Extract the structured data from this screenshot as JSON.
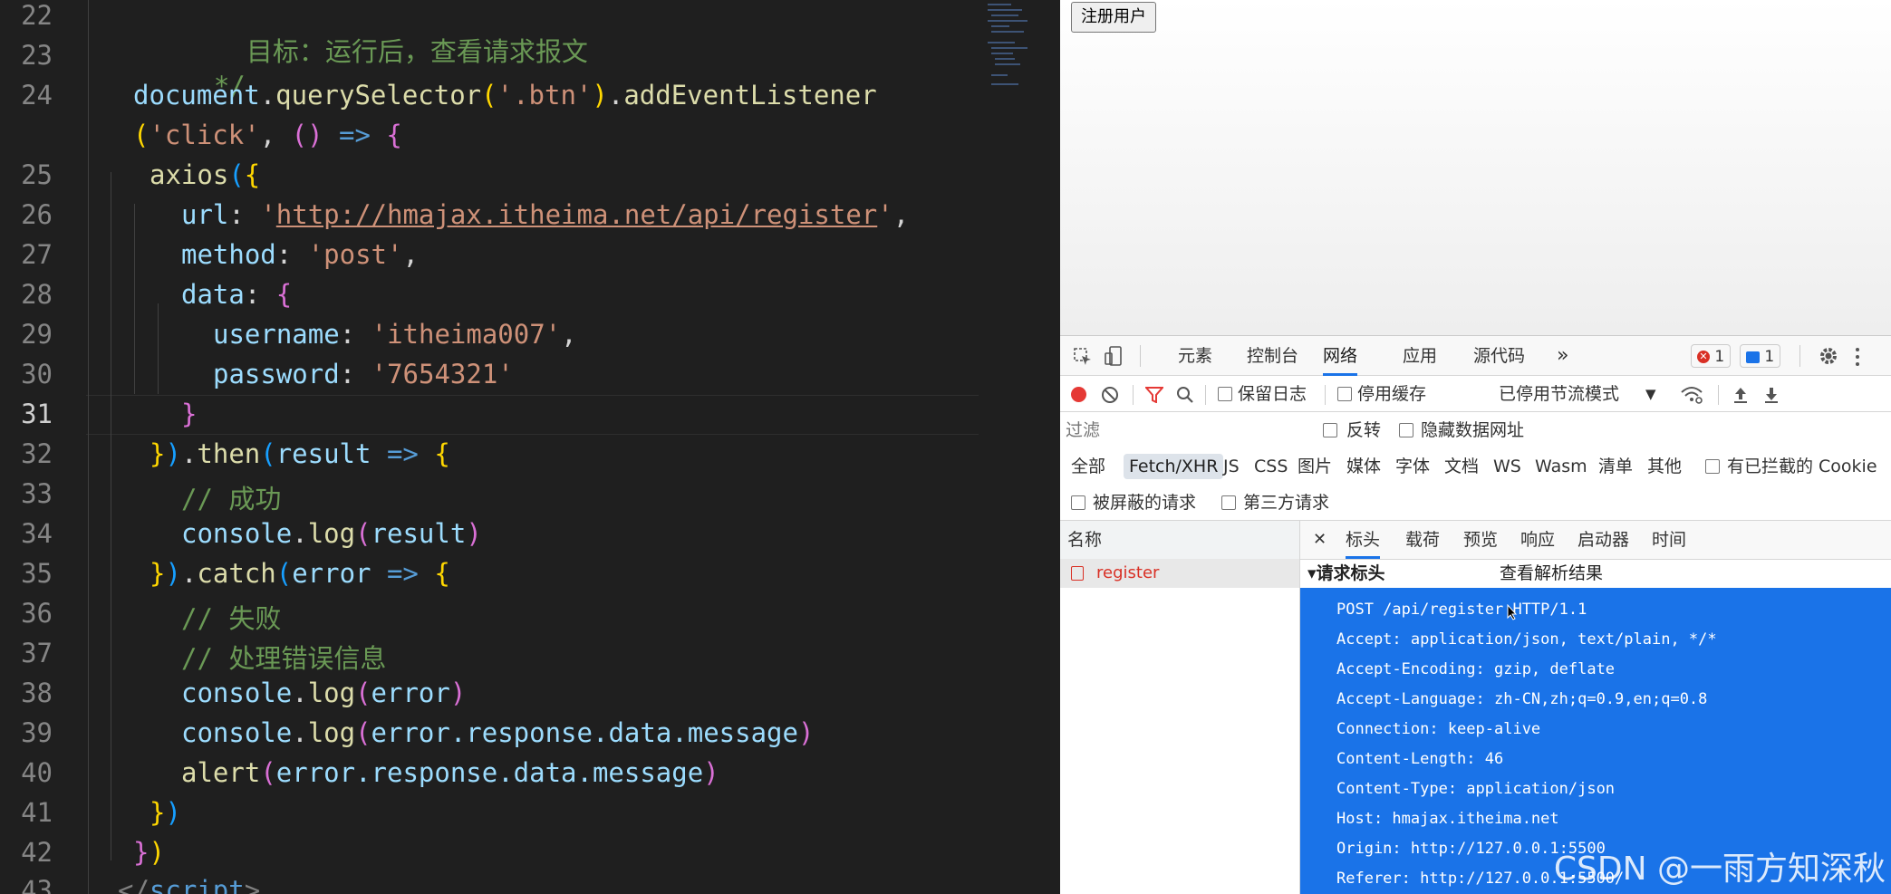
{
  "editor": {
    "line_numbers": [
      "22",
      "23",
      "24",
      "",
      "25",
      "26",
      "27",
      "28",
      "29",
      "30",
      "31",
      "32",
      "33",
      "34",
      "35",
      "36",
      "37",
      "38",
      "39",
      "40",
      "41",
      "42",
      "43"
    ],
    "active_line": "31",
    "code": {
      "l22": "目标：运行后，查看请求报文",
      "l23": "*/",
      "l24_doc": "document",
      "l24_dot": ".",
      "l24_qs": "querySelector",
      "l24_p1": "(",
      "l24_sel": "'.btn'",
      "l24_p2": ")",
      "l24_dot2": ".",
      "l24_ael": "addEventListener",
      "l24b_p": "(",
      "l24b_evt": "'click'",
      "l24b_c": ", ",
      "l24b_args": "()",
      "l24b_arrow": " => ",
      "l24b_brace": "{",
      "l25_axios": "axios",
      "l25_p": "(",
      "l25_b": "{",
      "l26_key": "url",
      "l26_colon": ": ",
      "l26_q1": "'",
      "l26_url": "http://hmajax.itheima.net/api/register",
      "l26_q2": "'",
      "l26_comma": ",",
      "l27_key": "method",
      "l27_colon": ": ",
      "l27_val": "'post'",
      "l27_comma": ",",
      "l28_key": "data",
      "l28_colon": ": ",
      "l28_b": "{",
      "l29_key": "username",
      "l29_colon": ": ",
      "l29_val": "'itheima007'",
      "l29_comma": ",",
      "l30_key": "password",
      "l30_colon": ": ",
      "l30_val": "'7654321'",
      "l31_b": "}",
      "l32_b": "}",
      "l32_p": ")",
      "l32_dot": ".",
      "l32_then": "then",
      "l32_p2": "(",
      "l32_arg": "result",
      "l32_arrow": " => ",
      "l32_brace": "{",
      "l33_cmt": "// 成功",
      "l34_obj": "console",
      "l34_dot": ".",
      "l34_fn": "log",
      "l34_p1": "(",
      "l34_arg": "result",
      "l34_p2": ")",
      "l35_b": "}",
      "l35_p": ")",
      "l35_dot": ".",
      "l35_catch": "catch",
      "l35_p2": "(",
      "l35_arg": "error",
      "l35_arrow": " => ",
      "l35_brace": "{",
      "l36_cmt": "// 失败",
      "l37_cmt": "// 处理错误信息",
      "l38_obj": "console",
      "l38_dot": ".",
      "l38_fn": "log",
      "l38_p1": "(",
      "l38_arg": "error",
      "l38_p2": ")",
      "l39_obj": "console",
      "l39_dot": ".",
      "l39_fn": "log",
      "l39_p1": "(",
      "l39_arg": "error.response.data.message",
      "l39_p2": ")",
      "l40_fn": "alert",
      "l40_p1": "(",
      "l40_arg": "error.response.data.message",
      "l40_p2": ")",
      "l41_b": "}",
      "l41_p": ")",
      "l42_b": "}",
      "l42_p": ")",
      "l43_open": "</",
      "l43_tag": "script",
      "l43_close": ">"
    }
  },
  "browser": {
    "page": {
      "register_button": "注册用户"
    },
    "devtools": {
      "tabs": [
        "元素",
        "控制台",
        "网络",
        "应用",
        "源代码"
      ],
      "active_tab": "网络",
      "more_tabs": "»",
      "error_count": "1",
      "message_count": "1",
      "toolbar": {
        "preserve_log": "保留日志",
        "disable_cache": "停用缓存",
        "throttling": "已停用节流模式"
      },
      "filter": {
        "placeholder": "过滤",
        "invert": "反转",
        "hide_data_urls": "隐藏数据网址"
      },
      "types": [
        "全部",
        "Fetch/XHR",
        "JS",
        "CSS",
        "图片",
        "媒体",
        "字体",
        "文档",
        "WS",
        "Wasm",
        "清单",
        "其他"
      ],
      "active_type": "Fetch/XHR",
      "blocked_cookies": "有已拦截的 Cookie",
      "blocked_requests": "被屏蔽的请求",
      "third_party": "第三方请求",
      "request_list": {
        "header": "名称",
        "items": [
          "register"
        ]
      },
      "detail_tabs": [
        "标头",
        "载荷",
        "预览",
        "响应",
        "启动器",
        "时间"
      ],
      "active_detail_tab": "标头",
      "section": {
        "title": "▾请求标头",
        "view_parsed": "查看解析结果"
      },
      "raw_headers": [
        "POST /api/register HTTP/1.1",
        "Accept: application/json, text/plain, */*",
        "Accept-Encoding: gzip, deflate",
        "Accept-Language: zh-CN,zh;q=0.9,en;q=0.8",
        "Connection: keep-alive",
        "Content-Length: 46",
        "Content-Type: application/json",
        "Host: hmajax.itheima.net",
        "Origin: http://127.0.0.1:5500",
        "Referer: http://127.0.0.1:5500/"
      ]
    }
  },
  "watermark": "CSDN @一雨方知深秋",
  "colors": {
    "editor_bg": "#1f1f1f",
    "accent_blue": "#1a73e8",
    "error_red": "#d93025",
    "string": "#ce9178",
    "keyword": "#569cd6",
    "comment": "#6a9955"
  }
}
